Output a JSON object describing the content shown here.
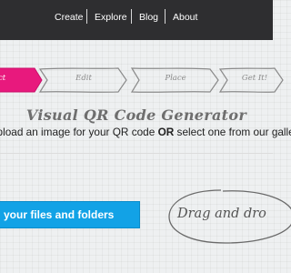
{
  "nav": {
    "items": [
      "Create",
      "Explore",
      "Blog",
      "About"
    ]
  },
  "steps": [
    {
      "label": "ct",
      "active": true
    },
    {
      "label": "Edit",
      "active": false
    },
    {
      "label": "Place",
      "active": false
    },
    {
      "label": "Get It!",
      "active": false
    }
  ],
  "title": "Visual QR Code Generator",
  "subtitle": {
    "before": "Upload an image for your QR code ",
    "bold": "OR",
    "after": " select one from our gallery"
  },
  "upload_button_label": "your files and folders",
  "drop_zone_label": "Drag and dro",
  "colors": {
    "nav_bg": "#2e2e30",
    "active_step": "#e8197d",
    "button": "#12a2e6"
  }
}
